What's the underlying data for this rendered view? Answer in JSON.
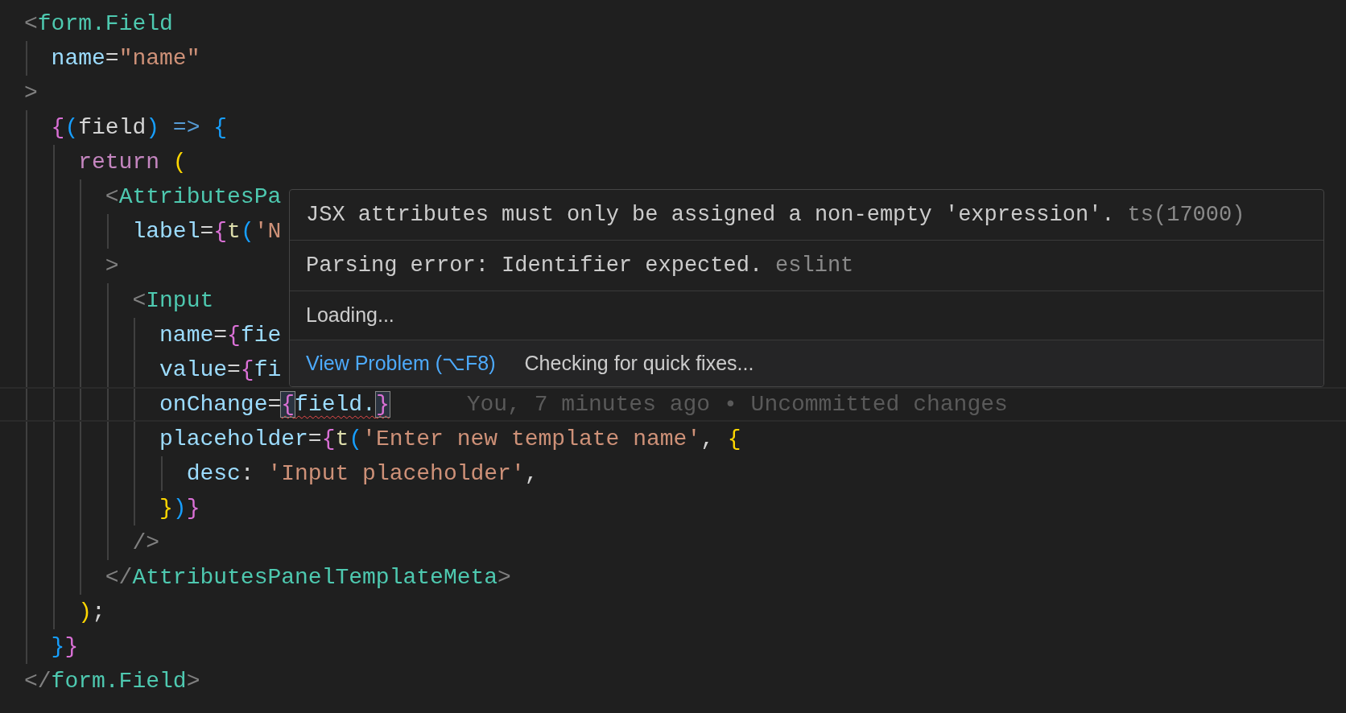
{
  "editor": {
    "lines": [
      {
        "tokens": [
          {
            "text": "<",
            "kind": "punct"
          },
          {
            "text": "form.Field",
            "kind": "tag"
          }
        ]
      },
      {
        "tokens": [
          {
            "text": "  name",
            "kind": "attr"
          },
          {
            "text": "=",
            "kind": "text"
          },
          {
            "text": "\"name\"",
            "kind": "string"
          }
        ]
      },
      {
        "tokens": [
          {
            "text": ">",
            "kind": "punct"
          }
        ]
      },
      {
        "tokens": [
          {
            "text": "  {",
            "kind": "brace1"
          },
          {
            "text": "(",
            "kind": "brace2"
          },
          {
            "text": "field",
            "kind": "text"
          },
          {
            "text": ")",
            "kind": "brace2"
          },
          {
            "text": " =>",
            "kind": "arrow"
          },
          {
            "text": " {",
            "kind": "brace2"
          }
        ]
      },
      {
        "tokens": [
          {
            "text": "    return",
            "kind": "keyword"
          },
          {
            "text": " (",
            "kind": "brace3"
          }
        ]
      },
      {
        "tokens": [
          {
            "text": "      <",
            "kind": "punct"
          },
          {
            "text": "AttributesPa",
            "kind": "tag"
          }
        ]
      },
      {
        "tokens": [
          {
            "text": "        label",
            "kind": "attr"
          },
          {
            "text": "=",
            "kind": "text"
          },
          {
            "text": "{",
            "kind": "brace1"
          },
          {
            "text": "t",
            "kind": "func"
          },
          {
            "text": "(",
            "kind": "brace2"
          },
          {
            "text": "'N",
            "kind": "string"
          }
        ]
      },
      {
        "tokens": [
          {
            "text": "      >",
            "kind": "punct"
          }
        ]
      },
      {
        "tokens": [
          {
            "text": "        <",
            "kind": "punct"
          },
          {
            "text": "Input",
            "kind": "tag"
          }
        ]
      },
      {
        "tokens": [
          {
            "text": "          name",
            "kind": "attr"
          },
          {
            "text": "=",
            "kind": "text"
          },
          {
            "text": "{",
            "kind": "brace1"
          },
          {
            "text": "fie",
            "kind": "attr"
          }
        ]
      },
      {
        "tokens": [
          {
            "text": "          value",
            "kind": "attr"
          },
          {
            "text": "=",
            "kind": "text"
          },
          {
            "text": "{",
            "kind": "brace1"
          },
          {
            "text": "fi",
            "kind": "attr"
          }
        ]
      },
      {
        "current": true,
        "blame": "You, 7 minutes ago • Uncommitted changes",
        "tokens": [
          {
            "text": "          onChange",
            "kind": "attr"
          },
          {
            "text": "=",
            "kind": "text"
          },
          {
            "text": "{",
            "kind": "brace1",
            "matched": true,
            "error": true
          },
          {
            "text": "field.",
            "kind": "attr",
            "error": true
          },
          {
            "text": "}",
            "kind": "brace1",
            "matched": true,
            "error": true
          }
        ]
      },
      {
        "tokens": [
          {
            "text": "          placeholder",
            "kind": "attr"
          },
          {
            "text": "=",
            "kind": "text"
          },
          {
            "text": "{",
            "kind": "brace1"
          },
          {
            "text": "t",
            "kind": "func"
          },
          {
            "text": "(",
            "kind": "brace2"
          },
          {
            "text": "'Enter new template name'",
            "kind": "string"
          },
          {
            "text": ", ",
            "kind": "text"
          },
          {
            "text": "{",
            "kind": "brace3"
          }
        ]
      },
      {
        "tokens": [
          {
            "text": "            desc",
            "kind": "attr"
          },
          {
            "text": ": ",
            "kind": "text"
          },
          {
            "text": "'Input placeholder'",
            "kind": "string"
          },
          {
            "text": ",",
            "kind": "text"
          }
        ]
      },
      {
        "tokens": [
          {
            "text": "          }",
            "kind": "brace3"
          },
          {
            "text": ")",
            "kind": "brace2"
          },
          {
            "text": "}",
            "kind": "brace1"
          }
        ]
      },
      {
        "tokens": [
          {
            "text": "        />",
            "kind": "punct"
          }
        ]
      },
      {
        "tokens": [
          {
            "text": "      </",
            "kind": "punct"
          },
          {
            "text": "AttributesPanelTemplateMeta",
            "kind": "tag"
          },
          {
            "text": ">",
            "kind": "punct"
          }
        ]
      },
      {
        "tokens": [
          {
            "text": "    )",
            "kind": "brace3"
          },
          {
            "text": ";",
            "kind": "text"
          }
        ]
      },
      {
        "tokens": [
          {
            "text": "  }",
            "kind": "brace2"
          },
          {
            "text": "}",
            "kind": "brace1"
          }
        ]
      },
      {
        "tokens": [
          {
            "text": "</",
            "kind": "punct"
          },
          {
            "text": "form.Field",
            "kind": "tag"
          },
          {
            "text": ">",
            "kind": "punct"
          }
        ]
      }
    ]
  },
  "hover": {
    "problems": [
      {
        "message": "JSX attributes must only be assigned a non-empty 'expression'.",
        "source": "ts(17000)"
      },
      {
        "message": "Parsing error: Identifier expected.",
        "source": "eslint"
      }
    ],
    "loading": "Loading...",
    "actions": [
      {
        "label": "View Problem (⌥F8)",
        "kind": "link"
      },
      {
        "label": "Checking for quick fixes...",
        "kind": "status"
      }
    ]
  }
}
